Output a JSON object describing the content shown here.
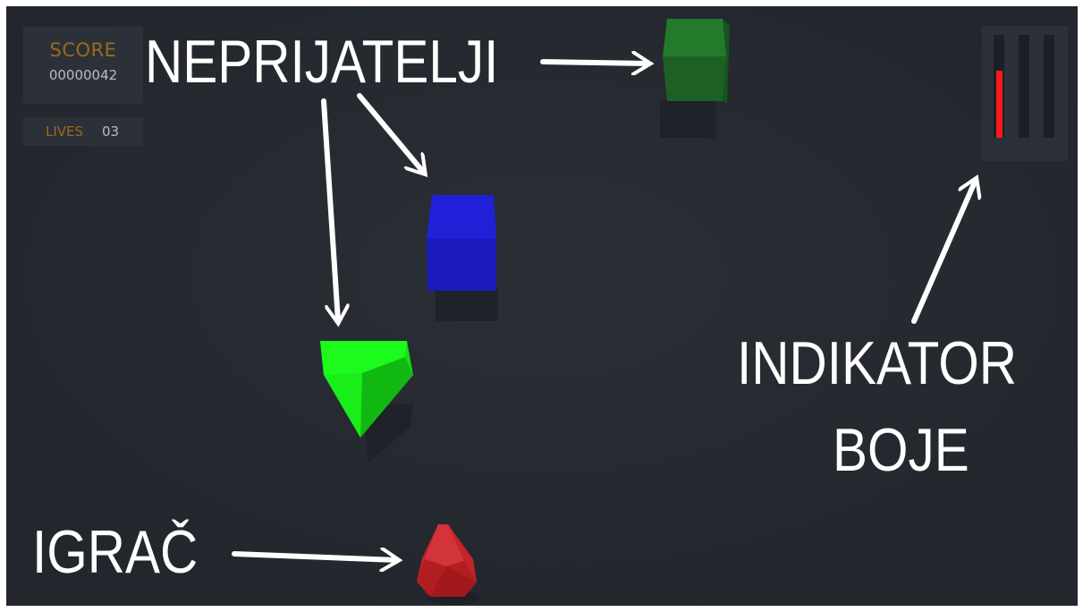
{
  "hud": {
    "score_label": "SCORE",
    "score_value": "00000042",
    "lives_label": "LIVES",
    "lives_value": "03",
    "label_color": "#9a6a1e",
    "value_color": "#b9bcc2"
  },
  "color_indicator": {
    "bars": [
      {
        "color": "red",
        "level": 0.65,
        "fill": "#ff1a1a"
      },
      {
        "color": "green",
        "level": 0.0,
        "fill": "#1aff1a"
      },
      {
        "color": "blue",
        "level": 0.0,
        "fill": "#1a1aff"
      }
    ]
  },
  "annotations": {
    "enemies": "NEPRIJATELJI",
    "player": "IGRAČ",
    "indicator_line1": "INDIKATOR",
    "indicator_line2": "BOJE"
  },
  "objects": {
    "enemy_dark_green": {
      "shape": "cube",
      "color": "#1f6a26"
    },
    "enemy_blue": {
      "shape": "cube",
      "color": "#1c1ccf"
    },
    "enemy_green": {
      "shape": "pentagon-prism",
      "color": "#19f219"
    },
    "player": {
      "shape": "pentagon-pyramid",
      "color": "#c8262a"
    }
  }
}
